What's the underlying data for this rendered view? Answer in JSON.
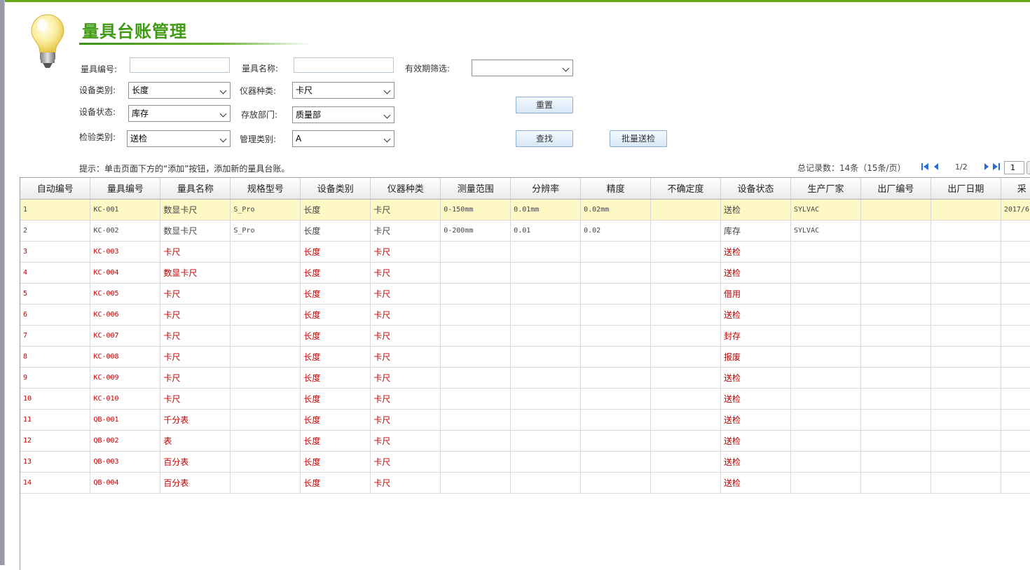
{
  "page": {
    "title": "量具台账管理"
  },
  "filters": {
    "gauge_code_label": "量具编号:",
    "gauge_code_value": "",
    "gauge_name_label": "量具名称:",
    "gauge_name_value": "",
    "validity_label": "有效期筛选:",
    "validity_value": "",
    "device_category_label": "设备类别:",
    "device_category_value": "长度",
    "instrument_type_label": "仪器种类:",
    "instrument_type_value": "卡尺",
    "device_status_label": "设备状态:",
    "device_status_value": "库存",
    "storage_dept_label": "存放部门:",
    "storage_dept_value": "质量部",
    "inspection_type_label": "检验类别:",
    "inspection_type_value": "送检",
    "management_type_label": "管理类别:",
    "management_type_value": "A"
  },
  "buttons": {
    "reset": "重置",
    "search": "查找",
    "batch_inspect": "批量送检"
  },
  "hint": "提示：单击页面下方的“添加”按钮，添加新的量具台账。",
  "pager": {
    "total_text": "总记录数：14条（15条/页）",
    "page_info": "1/2",
    "current_page": "1"
  },
  "table": {
    "columns": [
      "自动编号",
      "量具编号",
      "量具名称",
      "规格型号",
      "设备类别",
      "仪器种类",
      "测量范围",
      "分辨率",
      "精度",
      "不确定度",
      "设备状态",
      "生产厂家",
      "出厂编号",
      "出厂日期",
      "采"
    ],
    "rows": [
      [
        "1",
        "KC-001",
        "数显卡尺",
        "S_Pro",
        "长度",
        "卡尺",
        "0-150mm",
        "0.01mm",
        "0.02mm",
        "",
        "送检",
        "SYLVAC",
        "",
        "",
        "2017/6"
      ],
      [
        "2",
        "KC-002",
        "数显卡尺",
        "S_Pro",
        "长度",
        "卡尺",
        "0-200mm",
        "0.01",
        "0.02",
        "",
        "库存",
        "SYLVAC",
        "",
        "",
        ""
      ],
      [
        "3",
        "KC-003",
        "卡尺",
        "",
        "长度",
        "卡尺",
        "",
        "",
        "",
        "",
        "送检",
        "",
        "",
        "",
        ""
      ],
      [
        "4",
        "KC-004",
        "数显卡尺",
        "",
        "长度",
        "卡尺",
        "",
        "",
        "",
        "",
        "送检",
        "",
        "",
        "",
        ""
      ],
      [
        "5",
        "KC-005",
        "卡尺",
        "",
        "长度",
        "卡尺",
        "",
        "",
        "",
        "",
        "借用",
        "",
        "",
        "",
        ""
      ],
      [
        "6",
        "KC-006",
        "卡尺",
        "",
        "长度",
        "卡尺",
        "",
        "",
        "",
        "",
        "送检",
        "",
        "",
        "",
        ""
      ],
      [
        "7",
        "KC-007",
        "卡尺",
        "",
        "长度",
        "卡尺",
        "",
        "",
        "",
        "",
        "封存",
        "",
        "",
        "",
        ""
      ],
      [
        "8",
        "KC-008",
        "卡尺",
        "",
        "长度",
        "卡尺",
        "",
        "",
        "",
        "",
        "报废",
        "",
        "",
        "",
        ""
      ],
      [
        "9",
        "KC-009",
        "卡尺",
        "",
        "长度",
        "卡尺",
        "",
        "",
        "",
        "",
        "送检",
        "",
        "",
        "",
        ""
      ],
      [
        "10",
        "KC-010",
        "卡尺",
        "",
        "长度",
        "卡尺",
        "",
        "",
        "",
        "",
        "送检",
        "",
        "",
        "",
        ""
      ],
      [
        "11",
        "QB-001",
        "千分表",
        "",
        "长度",
        "卡尺",
        "",
        "",
        "",
        "",
        "送检",
        "",
        "",
        "",
        ""
      ],
      [
        "12",
        "QB-002",
        "表",
        "",
        "长度",
        "卡尺",
        "",
        "",
        "",
        "",
        "送检",
        "",
        "",
        "",
        ""
      ],
      [
        "13",
        "QB-003",
        "百分表",
        "",
        "长度",
        "卡尺",
        "",
        "",
        "",
        "",
        "送检",
        "",
        "",
        "",
        ""
      ],
      [
        "14",
        "QB-004",
        "百分表",
        "",
        "长度",
        "卡尺",
        "",
        "",
        "",
        "",
        "送检",
        "",
        "",
        "",
        ""
      ]
    ],
    "row_styles": [
      "selected",
      "normal",
      "red",
      "red",
      "red",
      "red",
      "red",
      "red",
      "red",
      "red",
      "red",
      "red",
      "red",
      "red"
    ]
  },
  "colors": {
    "title_green": "#3f9a14",
    "selected_row": "#fdf8c4",
    "red_text": "#c00000",
    "pager_blue": "#2a6fd8"
  }
}
